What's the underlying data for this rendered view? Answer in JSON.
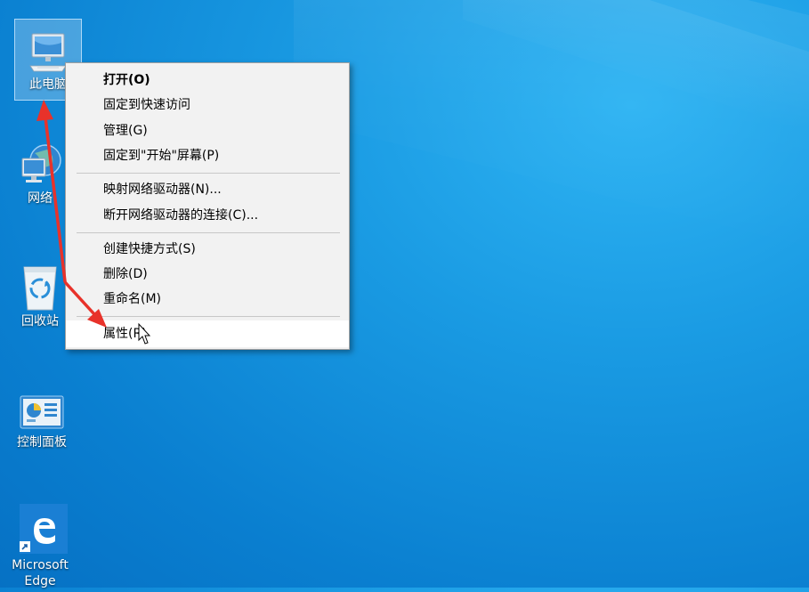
{
  "desktop": {
    "icons": [
      {
        "label": "此电脑",
        "icon": "computer-icon"
      },
      {
        "label": "网络",
        "icon": "network-icon"
      },
      {
        "label": "回收站",
        "icon": "recycle-bin-icon"
      },
      {
        "label": "控制面板",
        "icon": "control-panel-icon"
      },
      {
        "label": "Microsoft Edge",
        "icon": "edge-icon"
      }
    ]
  },
  "context_menu": {
    "items": [
      {
        "label": "打开(O)",
        "bold": true
      },
      {
        "label": "固定到快速访问"
      },
      {
        "label": "管理(G)"
      },
      {
        "label": "固定到\"开始\"屏幕(P)"
      },
      {
        "label": "映射网络驱动器(N)..."
      },
      {
        "label": "断开网络驱动器的连接(C)..."
      },
      {
        "label": "创建快捷方式(S)"
      },
      {
        "label": "删除(D)"
      },
      {
        "label": "重命名(M)"
      },
      {
        "label": "属性(R)",
        "hovered": true
      }
    ]
  },
  "colors": {
    "desktop_bg": "#0a7fd0",
    "annotation_arrow": "#e8322a",
    "menu_bg": "#f2f2f2"
  }
}
